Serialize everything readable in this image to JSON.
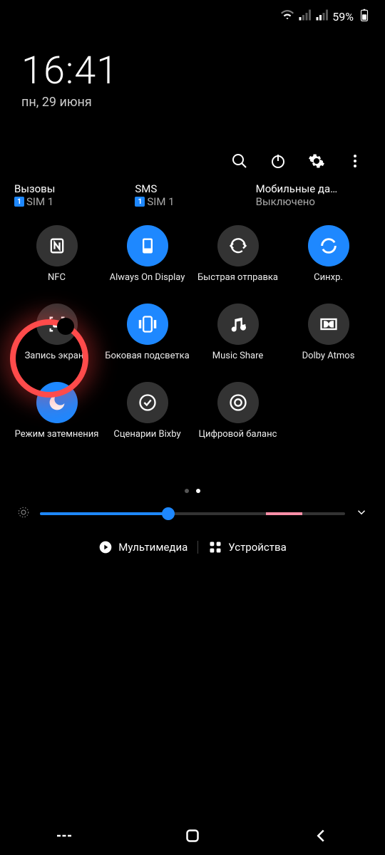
{
  "status": {
    "battery": "59%"
  },
  "clock": {
    "time": "16:41",
    "date": "пн, 29 июня"
  },
  "sims": [
    {
      "title": "Вызовы",
      "sub": "SIM 1",
      "badge": "1"
    },
    {
      "title": "SMS",
      "sub": "SIM 1",
      "badge": "1"
    },
    {
      "title": "Мобильные да…",
      "sub": "Выключено",
      "badge": ""
    }
  ],
  "tiles": [
    {
      "label": "NFC",
      "on": false,
      "icon": "nfc"
    },
    {
      "label": "Always On Display",
      "on": true,
      "icon": "aod"
    },
    {
      "label": "Быстрая отправка",
      "on": false,
      "icon": "quickshare"
    },
    {
      "label": "Синхр.",
      "on": true,
      "icon": "sync"
    },
    {
      "label": "Запись экрана",
      "on": false,
      "icon": "screenrec"
    },
    {
      "label": "Боковая подсветка",
      "on": true,
      "icon": "edgelight"
    },
    {
      "label": "Music Share",
      "on": false,
      "icon": "musicshare"
    },
    {
      "label": "Dolby Atmos",
      "on": false,
      "icon": "dolby"
    },
    {
      "label": "Режим затемнения",
      "on": true,
      "icon": "dark"
    },
    {
      "label": "Сценарии Bixby",
      "on": false,
      "icon": "bixby"
    },
    {
      "label": "Цифровой баланс",
      "on": false,
      "icon": "wellbeing"
    }
  ],
  "pager": {
    "total": 2,
    "active": 1
  },
  "brightness": {
    "value": 42
  },
  "bottom": {
    "media": "Мультимедиа",
    "devices": "Устройства"
  },
  "annotation_tile_index": 4
}
